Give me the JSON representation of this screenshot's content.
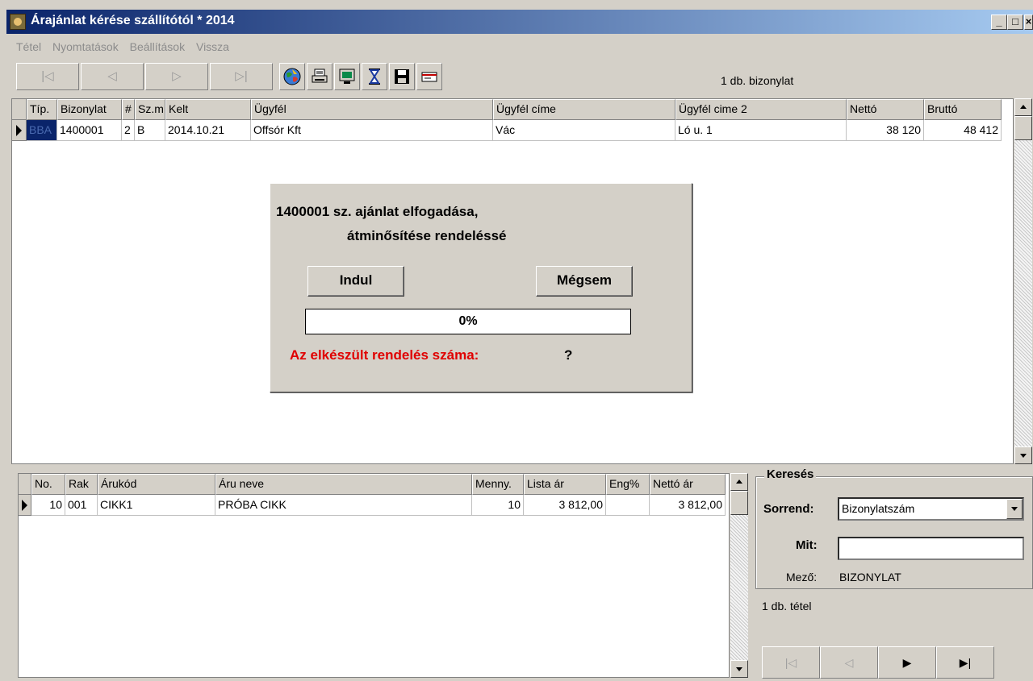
{
  "window": {
    "title": "Árajánlat kérése szállítótól * 2014",
    "minimize_icon": "minimize-icon",
    "maximize_icon": "maximize-icon",
    "close_icon": "close-icon",
    "min_glyph": "_",
    "max_glyph": "□",
    "close_glyph": "×"
  },
  "menu": [
    "Tétel",
    "Nyomtatások",
    "Beállítások",
    "Vissza"
  ],
  "toolbar": {
    "nav": [
      "|◁",
      "◁",
      "▷",
      "▷|"
    ],
    "tools": [
      "globe-icon",
      "printer-icon",
      "monitor-icon",
      "hourglass-icon",
      "save-icon",
      "card-icon"
    ],
    "count": "1 db. bizonylat"
  },
  "upper_grid": {
    "headers": [
      "Típ.",
      "Bizonylat",
      "#",
      "Sz.m",
      "Kelt",
      "Ügyfél",
      "Ügyfél címe",
      "Ügyfél cime 2",
      "Nettó",
      "Bruttó"
    ],
    "rows": [
      [
        "BBA",
        "1400001",
        "2",
        "B",
        "2014.10.21",
        "Offsór Kft",
        "Vác",
        "Ló u. 1",
        "38 120",
        "48 412"
      ]
    ]
  },
  "dialog": {
    "line1": "1400001  sz. ajánlat elfogadása,",
    "line2": "átminősítése rendeléssé",
    "start_button": "Indul",
    "cancel_button": "Mégsem",
    "progress_value": 0,
    "progress_text": "0%",
    "result_label": "Az elkészült rendelés száma:",
    "result_value": "?"
  },
  "lower_grid": {
    "headers": [
      "No.",
      "Rak",
      "Árukód",
      "Áru neve",
      "Menny.",
      "Lista ár",
      "Eng%",
      "Nettó ár"
    ],
    "rows": [
      [
        "10",
        "001",
        "CIKK1",
        "PRÓBA CIKK",
        "10",
        "3 812,00",
        "",
        "3 812,00"
      ]
    ]
  },
  "search": {
    "title": "Keresés",
    "order_label": "Sorrend:",
    "order_value": "Bizonylatszám",
    "what_label": "Mit:",
    "what_value": "",
    "field_label": "Mező:",
    "field_value": "BIZONYLAT",
    "count": "1 db. tétel",
    "nav": [
      "|◁",
      "◁",
      "▶",
      "▶|"
    ]
  }
}
